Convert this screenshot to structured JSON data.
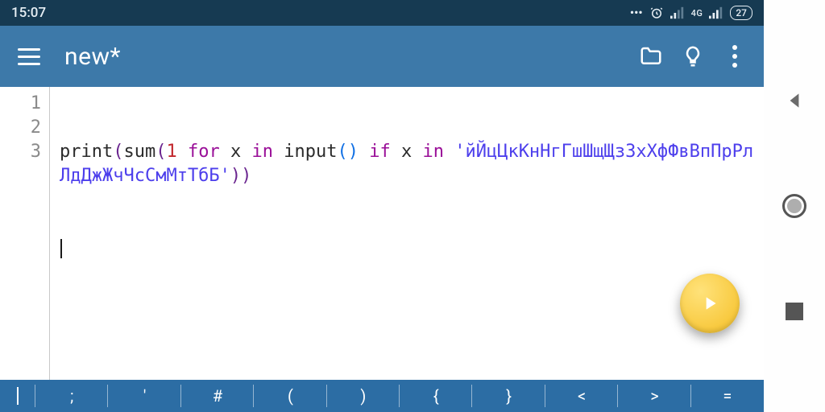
{
  "statusbar": {
    "time": "15:07",
    "network_label": "4G",
    "battery_text": "27"
  },
  "toolbar": {
    "title": "new*"
  },
  "editor": {
    "line_numbers": [
      "1",
      "2",
      "3"
    ],
    "code": {
      "fn_print": "print",
      "fn_sum": "sum",
      "num_one": "1",
      "kw_for": "for",
      "id_x1": "x",
      "kw_in1": "in",
      "fn_input": "input",
      "kw_if": "if",
      "id_x2": "x",
      "kw_in2": "in",
      "str_literal": "'йЙцЦкКнНгГшШщЩзЗхХфФвВпПрРлЛдДжЖчЧсСмМтТбБ'"
    }
  },
  "symbar": {
    "keys": [
      ";",
      "'",
      "#",
      "(",
      ")",
      "{",
      "}",
      "<",
      ">",
      "="
    ]
  }
}
